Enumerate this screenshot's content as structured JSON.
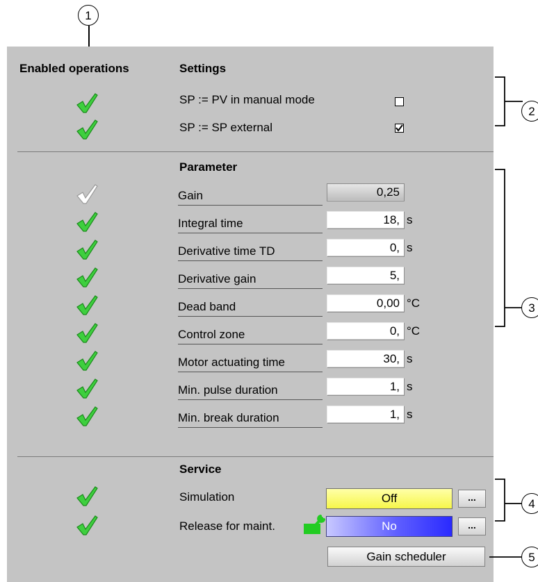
{
  "headers": {
    "enabled_operations": "Enabled operations",
    "settings": "Settings",
    "parameter": "Parameter",
    "service": "Service"
  },
  "settings": [
    {
      "label": "SP := PV in manual mode",
      "checked": false,
      "enabled": true
    },
    {
      "label": "SP := SP external",
      "checked": true,
      "enabled": true
    }
  ],
  "parameters": [
    {
      "label": "Gain",
      "value": "0,25",
      "unit": "",
      "enabled": false
    },
    {
      "label": "Integral time",
      "value": "18,",
      "unit": "s",
      "enabled": true
    },
    {
      "label": "Derivative time TD",
      "value": "0,",
      "unit": "s",
      "enabled": true
    },
    {
      "label": "Derivative gain",
      "value": "5,",
      "unit": "",
      "enabled": true
    },
    {
      "label": "Dead band",
      "value": "0,00",
      "unit": "°C",
      "enabled": true
    },
    {
      "label": "Control zone",
      "value": "0,",
      "unit": "°C",
      "enabled": true
    },
    {
      "label": "Motor actuating time",
      "value": "30,",
      "unit": "s",
      "enabled": true
    },
    {
      "label": "Min. pulse duration",
      "value": "1,",
      "unit": "s",
      "enabled": true
    },
    {
      "label": "Min. break duration",
      "value": "1,",
      "unit": "s",
      "enabled": true
    }
  ],
  "service": {
    "simulation": {
      "label": "Simulation",
      "value": "Off",
      "button": "...",
      "enabled": true
    },
    "maintenance": {
      "label": "Release for maint.",
      "value": "No",
      "button": "...",
      "enabled": true
    },
    "gain_scheduler": "Gain scheduler"
  },
  "callouts": [
    "1",
    "2",
    "3",
    "4",
    "5"
  ],
  "colors": {
    "panel": "#c4c4c4",
    "check_enabled": "#3ecf3e",
    "check_disabled": "#a8a8a8",
    "simulation_bg": "#ffff66",
    "maintenance_bg": "#3030ff"
  }
}
